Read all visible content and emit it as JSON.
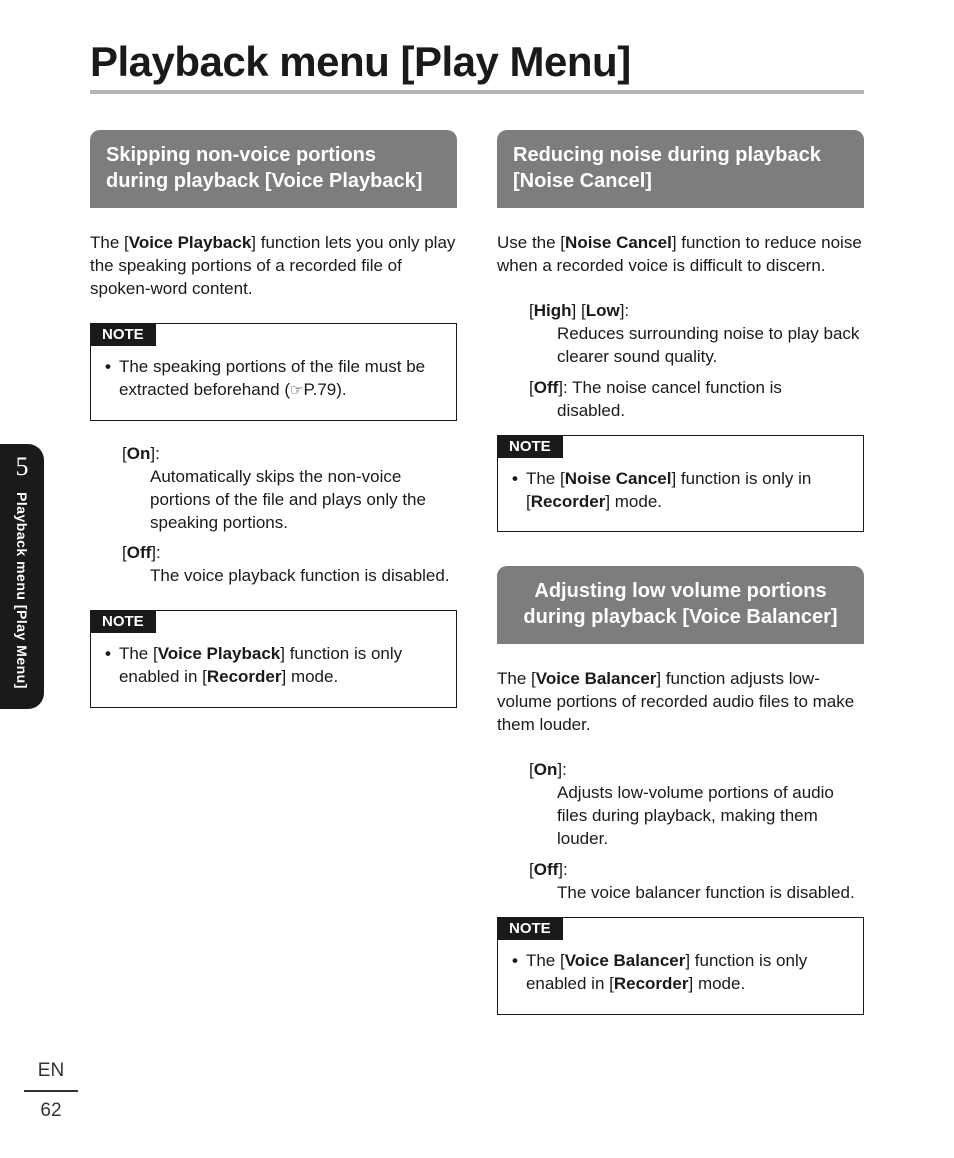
{
  "page": {
    "title": "Playback menu [Play Menu]",
    "chapter": "5",
    "side_label": "Playback menu [Play Menu]",
    "lang": "EN",
    "number": "62"
  },
  "voice_playback": {
    "header": "Skipping non-voice portions during playback [Voice Playback]",
    "intro_pre": "The [",
    "intro_b": "Voice Playback",
    "intro_post": "] function lets you only play the speaking portions of a recorded file of spoken-word content.",
    "note1_label": "NOTE",
    "note1_text": "The speaking portions of the file must be extracted beforehand (",
    "note1_ref": "P.79).",
    "on_label": "On",
    "on_desc": "Automatically skips the non-voice portions of the file and plays only the speaking portions.",
    "off_label": "Off",
    "off_desc": "The voice playback function is disabled.",
    "note2_label": "NOTE",
    "note2_pre": "The [",
    "note2_b1": "Voice Playback",
    "note2_mid": "] function is only enabled in [",
    "note2_b2": "Recorder",
    "note2_post": "] mode."
  },
  "noise_cancel": {
    "header": "Reducing noise during playback [Noise Cancel]",
    "intro_pre": "Use the [",
    "intro_b": "Noise Cancel",
    "intro_post": "] function to reduce noise when a recorded voice is difficult to discern.",
    "hl_high": "High",
    "hl_low": "Low",
    "hl_desc": "Reduces surrounding noise to play back clearer sound quality.",
    "off_label": "Off",
    "off_desc": "]: The noise cancel function is",
    "off_cont": "disabled.",
    "note_label": "NOTE",
    "note_pre": "The [",
    "note_b1": "Noise Cancel",
    "note_mid": "] function is only in [",
    "note_b2": "Recorder",
    "note_post": "] mode."
  },
  "voice_balancer": {
    "header": "Adjusting low volume portions during playback [Voice Balancer]",
    "intro_pre": "The [",
    "intro_b": "Voice Balancer",
    "intro_post": "] function adjusts low-volume portions of recorded audio files to make them louder.",
    "on_label": "On",
    "on_desc": "Adjusts low-volume portions of audio files during playback, making them louder.",
    "off_label": "Off",
    "off_desc": "The voice balancer function is disabled.",
    "note_label": "NOTE",
    "note_pre": "The [",
    "note_b1": "Voice Balancer",
    "note_mid": "] function is only enabled in [",
    "note_b2": "Recorder",
    "note_post": "] mode."
  }
}
